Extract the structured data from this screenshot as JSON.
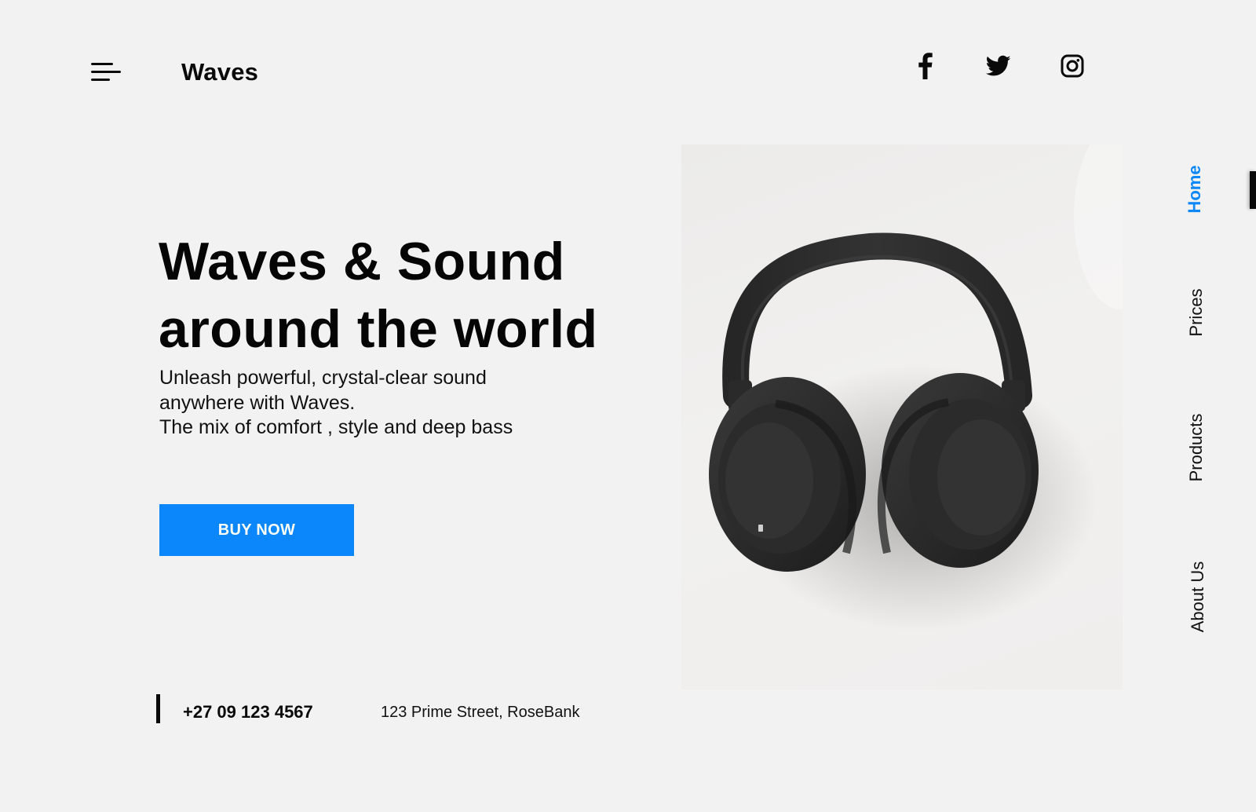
{
  "header": {
    "brand": "Waves",
    "menu_icon": "hamburger-menu-icon",
    "socials": [
      {
        "name": "facebook",
        "icon": "facebook-icon"
      },
      {
        "name": "twitter",
        "icon": "twitter-icon"
      },
      {
        "name": "instagram",
        "icon": "instagram-icon"
      }
    ]
  },
  "hero": {
    "title": "Waves & Sound around the world",
    "description_lines": [
      "Unleash powerful, crystal-clear sound",
      "anywhere with Waves.",
      "The mix of comfort , style and deep bass"
    ],
    "cta_label": "BUY NOW",
    "image_icon": "headphones-image"
  },
  "contact": {
    "phone": "+27 09 123 4567",
    "address": "123 Prime Street, RoseBank"
  },
  "side_nav": {
    "items": [
      {
        "label": "Home",
        "active": true
      },
      {
        "label": "Prices",
        "active": false
      },
      {
        "label": "Products",
        "active": false
      },
      {
        "label": "About Us",
        "active": false
      }
    ]
  },
  "colors": {
    "background": "#f2f2f2",
    "accent": "#0b87fb",
    "text": "#0a0a0a"
  }
}
